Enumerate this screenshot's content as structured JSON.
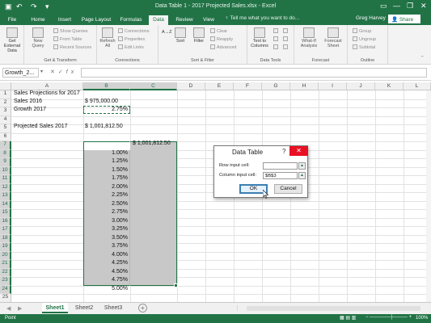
{
  "window": {
    "title": "Data Table 1 - 2017 Projected Sales.xlsx - Excel",
    "minimize_glyph": "—",
    "restore_glyph": "❐",
    "close_glyph": "✕",
    "save_icon": "save-icon",
    "undo_icon": "undo-icon",
    "redo_icon": "redo-icon"
  },
  "ribbon_tabs": [
    "File",
    "Home",
    "Insert",
    "Page Layout",
    "Formulas",
    "Data",
    "Review",
    "View"
  ],
  "active_tab": "Data",
  "tell_me": "Tell me what you want to do...",
  "user": "Greg Harvey",
  "share_label": "Share",
  "ribbon": {
    "get_external_data": "Get External Data",
    "new_query": "New Query",
    "show_queries": "Show Queries",
    "from_table": "From Table",
    "recent_sources": "Recent Sources",
    "get_transform": "Get & Transform",
    "refresh_all": "Refresh All",
    "connections": "Connections",
    "properties": "Properties",
    "edit_links": "Edit Links",
    "connections_group": "Connections",
    "sort_az": "A→Z",
    "sort": "Sort",
    "filter": "Filter",
    "clear": "Clear",
    "reapply": "Reapply",
    "advanced": "Advanced",
    "sort_filter": "Sort & Filter",
    "text_to_columns": "Text to Columns",
    "data_tools": "Data Tools",
    "what_if": "What-If Analysis",
    "forecast_sheet": "Forecast Sheet",
    "forecast_group": "Forecast",
    "group": "Group",
    "ungroup": "Ungroup",
    "subtotal": "Subtotal",
    "outline": "Outline"
  },
  "formula_bar": {
    "name_box": "Growth_2...",
    "formula": ""
  },
  "columns": [
    "A",
    "B",
    "C",
    "D",
    "E",
    "F",
    "G",
    "H",
    "I",
    "J",
    "K",
    "L"
  ],
  "rows": [
    "1",
    "2",
    "3",
    "4",
    "5",
    "6",
    "7",
    "8",
    "9",
    "10",
    "11",
    "12",
    "13",
    "14",
    "15",
    "16",
    "17",
    "18",
    "19",
    "20",
    "21",
    "22",
    "23",
    "24",
    "25",
    "26",
    "27"
  ],
  "cells": {
    "a1": "Sales Projections for 2017",
    "a2": "Sales 2016",
    "b2": "$    975,000.00",
    "a3": "Growth 2017",
    "b3": "2.75%",
    "a5": "Projected Sales 2017",
    "b5": "$ 1,001,812.50",
    "c7": "$ 1,001,812.50"
  },
  "growth_rates": [
    "1.00%",
    "1.25%",
    "1.50%",
    "1.75%",
    "2.00%",
    "2.25%",
    "2.50%",
    "2.75%",
    "3.00%",
    "3.25%",
    "3.50%",
    "3.75%",
    "4.00%",
    "4.25%",
    "4.50%",
    "4.75%",
    "5.00%"
  ],
  "sheets": [
    "Sheet1",
    "Sheet2",
    "Sheet3"
  ],
  "active_sheet": "Sheet1",
  "add_sheet": "+",
  "status": {
    "mode": "Point",
    "zoom": "100%"
  },
  "dialog": {
    "title": "Data Table",
    "help": "?",
    "close": "✕",
    "row_label": "Row input cell:",
    "row_value": "",
    "column_label": "Column input cell:",
    "column_value": "$B$3",
    "ok": "OK",
    "cancel": "Cancel"
  }
}
